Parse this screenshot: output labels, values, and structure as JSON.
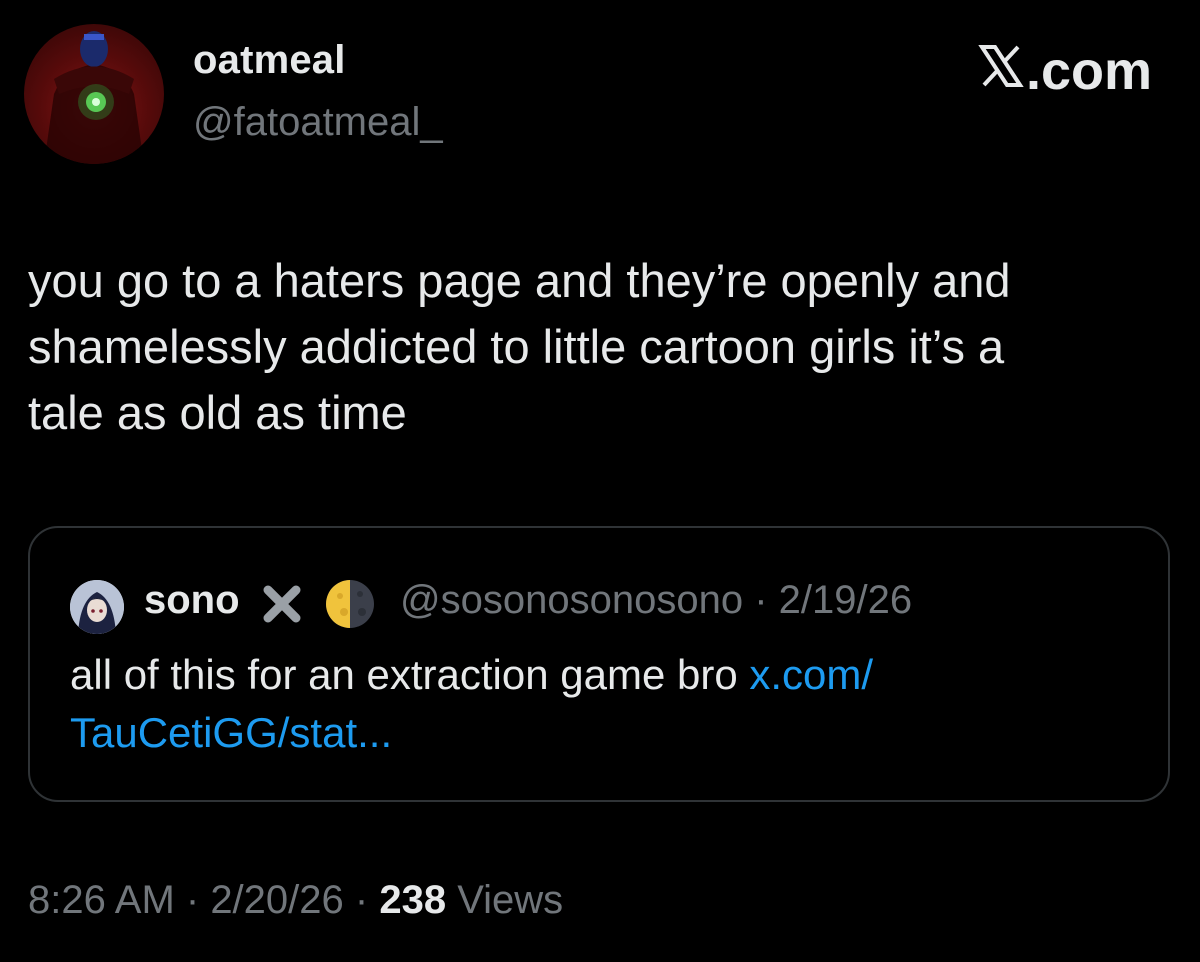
{
  "author": {
    "display_name": "oatmeal",
    "handle": "@fatoatmeal_"
  },
  "brand": {
    "label": ".com",
    "icon": "x-logo-icon"
  },
  "tweet": {
    "line1": "you go to a haters page and they’re openly and",
    "line2": "shamelessly addicted to little cartoon girls it’s a",
    "line3": "tale as old as time"
  },
  "quote": {
    "name": "sono",
    "emoji_1": "cross-mark-icon",
    "emoji_2": "moon-icon",
    "handle": "@sosonosonosono",
    "separator": " · ",
    "date": "2/19/26",
    "text": "all of this for an extraction game bro ",
    "link_part1": "x.com/",
    "link_part2": "TauCetiGG/stat..."
  },
  "meta": {
    "time": "8:26 AM",
    "separator": " · ",
    "date": "2/20/26",
    "views_count": "238",
    "views_label": " Views"
  },
  "colors": {
    "background": "#000000",
    "text": "#e7e9ea",
    "muted": "#71767b",
    "link": "#1d9bf0",
    "border": "#2f3336"
  }
}
